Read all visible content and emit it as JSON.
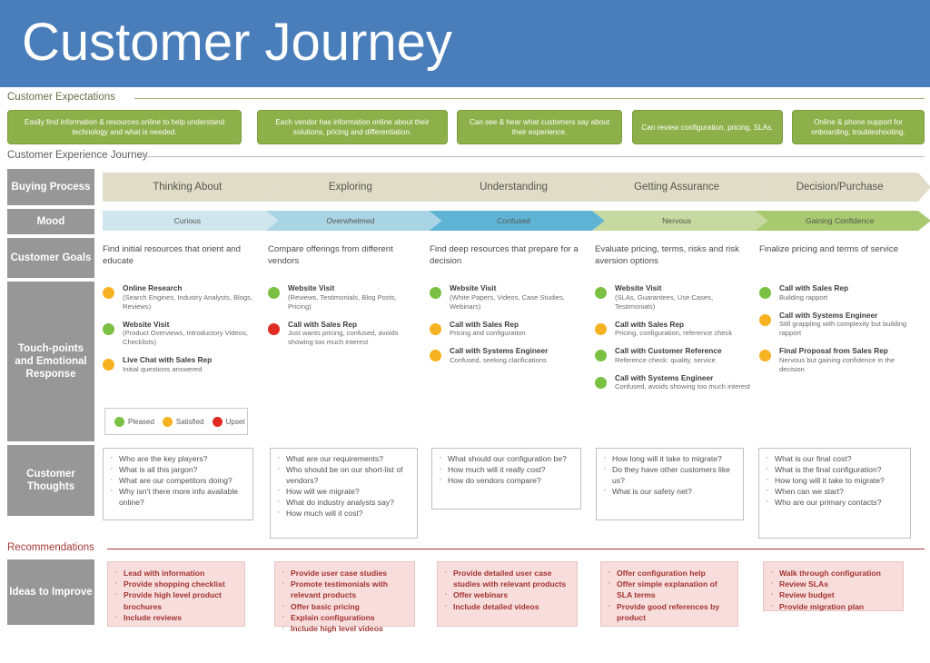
{
  "banner": {
    "title": "Customer Journey"
  },
  "sections": {
    "expectations_label": "Customer Expectations",
    "journey_label": "Customer Experience Journey",
    "recommendations_label": "Recommendations"
  },
  "expectations": [
    "Easily find information & resources online to help understand technology and what is needed.",
    "Each vendor has information online about their solutions, pricing and differentiation.",
    "Can see & hear what customers say about their experience.",
    "Can review configuration, pricing, SLAs.",
    "Online & phone support for onboarding, troubleshooting."
  ],
  "row_labels": {
    "buying_process": "Buying Process",
    "mood": "Mood",
    "customer_goals": "Customer Goals",
    "touchpoints": "Touch-points and Emotional Response",
    "customer_thoughts": "Customer Thoughts",
    "ideas_to_improve": "Ideas to Improve"
  },
  "buying_process": [
    {
      "label": "Thinking About",
      "color": "#e0dcc8"
    },
    {
      "label": "Exploring",
      "color": "#e0dcc8"
    },
    {
      "label": "Understanding",
      "color": "#e0dcc8"
    },
    {
      "label": "Getting Assurance",
      "color": "#e0dcc8"
    },
    {
      "label": "Decision/Purchase",
      "color": "#e0dcc8"
    }
  ],
  "mood": [
    {
      "label": "Curious",
      "color": "#cfe6ef"
    },
    {
      "label": "Overwhelmed",
      "color": "#a8d4e4"
    },
    {
      "label": "Confused",
      "color": "#5fb4d6"
    },
    {
      "label": "Nervous",
      "color": "#c5d9a0"
    },
    {
      "label": "Gaining Confidence",
      "color": "#a8c96f"
    }
  ],
  "customer_goals": [
    "Find initial resources that orient and educate",
    "Compare offerings from different vendors",
    "Find deep resources that prepare for a decision",
    "Evaluate pricing, terms, risks and risk aversion options",
    "Finalize pricing and terms of service"
  ],
  "touchpoints": [
    [
      {
        "dot": "amber",
        "title": "Online Research",
        "desc": "(Search Engines, Industry Analysts, Blogs, Reviews)"
      },
      {
        "dot": "green",
        "title": "Website Visit",
        "desc": "(Product Overviews, Introductory Videos, Checklists)"
      },
      {
        "dot": "amber",
        "title": "Live Chat with Sales Rep",
        "desc": "Initial questions answered"
      }
    ],
    [
      {
        "dot": "green",
        "title": "Website Visit",
        "desc": "(Reviews, Testimonials, Blog Posts, Pricing)"
      },
      {
        "dot": "red",
        "title": "Call with Sales Rep",
        "desc": "Just wants pricing, confused, avoids showing too much interest"
      }
    ],
    [
      {
        "dot": "green",
        "title": "Website Visit",
        "desc": "(White Papers, Videos, Case Studies, Webinars)"
      },
      {
        "dot": "amber",
        "title": "Call with Sales Rep",
        "desc": "Pricing and configuration"
      },
      {
        "dot": "amber",
        "title": "Call with Systems Engineer",
        "desc": "Confused, seeking clarifications"
      }
    ],
    [
      {
        "dot": "green",
        "title": "Website Visit",
        "desc": "(SLAs, Guarantees, Use Cases, Testimonials)"
      },
      {
        "dot": "amber",
        "title": "Call with Sales Rep",
        "desc": "Pricing, configuration, reference check"
      },
      {
        "dot": "green",
        "title": "Call with Customer Reference",
        "desc": "Reference check: quality, service"
      },
      {
        "dot": "green",
        "title": "Call with Systems Engineer",
        "desc": "Confused, avoids showing too much interest"
      }
    ],
    [
      {
        "dot": "green",
        "title": "Call with Sales Rep",
        "desc": "Building rapport"
      },
      {
        "dot": "amber",
        "title": "Call with Systems Engineer",
        "desc": "Still grappling with complexity but building rapport"
      },
      {
        "dot": "amber",
        "title": "Final Proposal from Sales Rep",
        "desc": "Nervous but gaining confidence in the decision"
      }
    ]
  ],
  "legend": [
    {
      "label": "Pleased",
      "color": "#7ac143"
    },
    {
      "label": "Satisfied",
      "color": "#f6b221"
    },
    {
      "label": "Upset",
      "color": "#e02b22"
    }
  ],
  "customer_thoughts": [
    [
      "Who are the key players?",
      "What is all this jargon?",
      "What are our competitors doing?",
      "Why isn't there more info available online?"
    ],
    [
      "What are our requirements?",
      "Who should be on our short-list of vendors?",
      "How will we migrate?",
      "What do industry analysts say?",
      "How much will it cost?"
    ],
    [
      "What should our configuration be?",
      "How much will it really cost?",
      "How do vendors compare?"
    ],
    [
      "How long will it take to migrate?",
      "Do they have other customers like us?",
      "What is our safety net?"
    ],
    [
      "What is our final cost?",
      "What is the final configuration?",
      "How long will it take to migrate?",
      "When can we start?",
      "Who are our primary contacts?"
    ]
  ],
  "recommendations": [
    [
      "Lead with information",
      "Provide shopping checklist",
      "Provide high level product brochures",
      "Include reviews"
    ],
    [
      "Provide user case studies",
      "Promote testimonials with relevant products",
      "Offer basic pricing",
      "Explain configurations",
      "Include high level videos"
    ],
    [
      "Provide detailed user case studies with relevant products",
      "Offer webinars",
      "Include detailed videos"
    ],
    [
      "Offer configuration help",
      "Offer simple explanation of SLA terms",
      "Provide good references by product"
    ],
    [
      "Walk through configuration",
      "Review SLAs",
      "Review budget",
      "Provide migration plan"
    ]
  ],
  "colors": {
    "banner": "#4a7ebb",
    "expectation_pill": "#8db04a",
    "row_label": "#979797",
    "recommendation_bg": "#f7dedd",
    "recommendation_text": "#a3332e"
  }
}
